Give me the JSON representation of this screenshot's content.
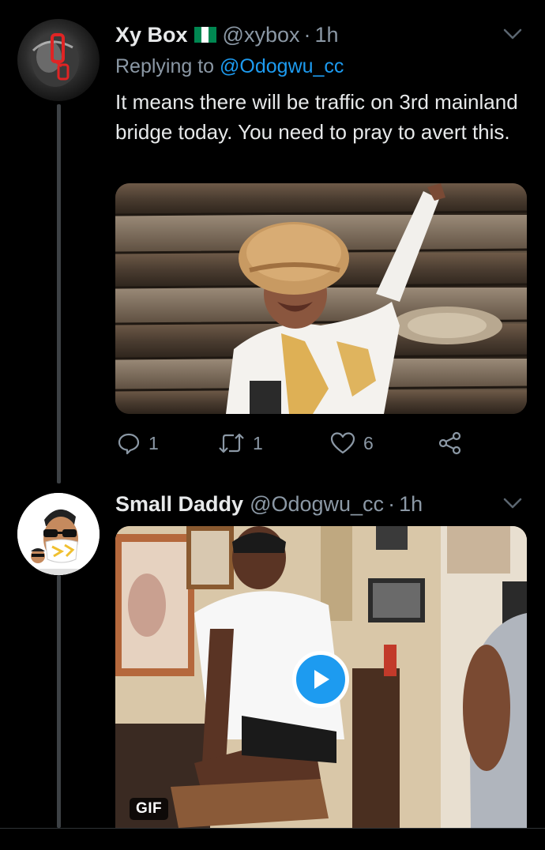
{
  "colors": {
    "background": "#000000",
    "text_primary": "#e7e9ea",
    "text_secondary": "#8b98a5",
    "accent": "#1d9bf0",
    "thread_line": "#3d4145"
  },
  "tweets": [
    {
      "display_name": "Xy Box",
      "flag_icon": "nigeria-flag-icon",
      "handle": "@xybox",
      "separator": "·",
      "time": "1h",
      "reply_prefix": "Replying to",
      "reply_mention": "@Odogwu_cc",
      "text": "It means there will be traffic on 3rd mainland bridge today. You need to pray to avert this.",
      "media_type": "photo",
      "actions": {
        "reply_count": "1",
        "retweet_count": "1",
        "like_count": "6"
      }
    },
    {
      "display_name": "Small Daddy",
      "handle": "@Odogwu_cc",
      "separator": "·",
      "time": "1h",
      "media_type": "gif",
      "gif_label": "GIF"
    }
  ],
  "icons": {
    "reply": "reply-icon",
    "retweet": "retweet-icon",
    "like": "heart-icon",
    "share": "share-icon",
    "more": "chevron-down-icon",
    "play": "play-icon"
  }
}
